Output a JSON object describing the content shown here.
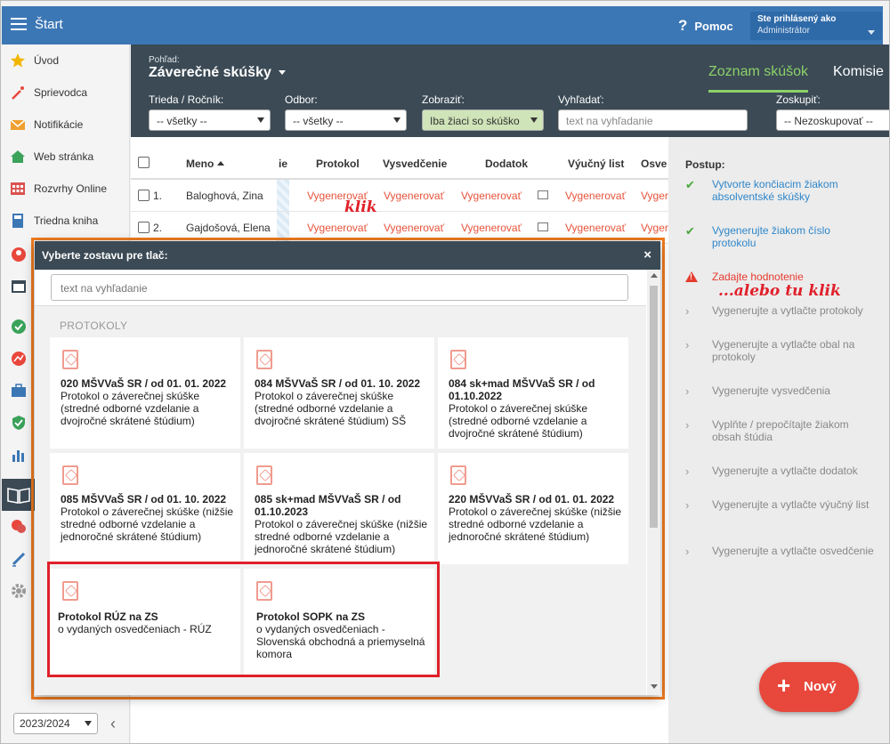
{
  "topbar": {
    "title": "Štart",
    "help": "Pomoc",
    "user_line1": "Ste prihlásený ako",
    "user_line2": "Administrátor"
  },
  "sidebar": {
    "items": [
      {
        "label": "Úvod",
        "icon": "star-icon",
        "color": "#f2b600"
      },
      {
        "label": "Sprievodca",
        "icon": "magic-wand-icon",
        "color": "#e8473c"
      },
      {
        "label": "Notifikácie",
        "icon": "envelope-icon",
        "color": "#f0a030"
      },
      {
        "label": "Web stránka",
        "icon": "home-icon",
        "color": "#3ba25a"
      },
      {
        "label": "Rozvrhy Online",
        "icon": "calendar-grid-icon",
        "color": "#d9534f"
      },
      {
        "label": "Triedna kniha",
        "icon": "book-icon",
        "color": "#3c77b5"
      }
    ],
    "year": "2023/2024"
  },
  "view": {
    "label": "Pohľad:",
    "title": "Záverečné skúšky",
    "tab_active": "Zoznam skúšok",
    "tab_other": "Komisie"
  },
  "filters": [
    {
      "label": "Trieda / Ročník:",
      "value": "-- všetky --"
    },
    {
      "label": "Odbor:",
      "value": "-- všetky --"
    },
    {
      "label": "Zobraziť:",
      "value": "Iba žiaci so skúško"
    },
    {
      "label": "Vyhľadať:",
      "value": "text na vyhľadanie"
    },
    {
      "label": "Zoskupiť:",
      "value": "-- Nezoskupovať --"
    }
  ],
  "table": {
    "headers": [
      "Meno",
      "ie",
      "Protokol",
      "Vysvedčenie",
      "Dodatok",
      "Výučný list",
      "Osve"
    ],
    "rows": [
      {
        "num": "1.",
        "name": "Baloghová, Zina",
        "protokol": "Vygenerovať",
        "vysvedcenie": "Vygenerovať",
        "dodatok": "Vygenerovať",
        "vyucny": "Vygenerovať",
        "osv": "Vyger"
      },
      {
        "num": "2.",
        "name": "Gajdošová, Elena",
        "protokol": "Vygenerovať",
        "vysvedcenie": "Vygenerovať",
        "dodatok": "Vygenerovať",
        "vyucny": "Vygenerovať",
        "osv": "Vyger"
      }
    ]
  },
  "annotations": {
    "klik": "klik",
    "alebo": "...alebo tu klik"
  },
  "steps": {
    "header": "Postup:",
    "items": [
      {
        "text": "Vytvorte končiacim žiakom absolventské skúšky",
        "state": "done"
      },
      {
        "text": "Vygenerujte žiakom číslo protokolu",
        "state": "done"
      },
      {
        "text": "Zadajte hodnotenie",
        "state": "warn"
      },
      {
        "text": "Vygenerujte a vytlačte protokoly",
        "state": "todo"
      },
      {
        "text": "Vygenerujte a vytlačte obal na protokoly",
        "state": "todo"
      },
      {
        "text": "Vygenerujte vysvedčenia",
        "state": "todo"
      },
      {
        "text": "Vyplňte / prepočítajte žiakom obsah štúdia",
        "state": "todo"
      },
      {
        "text": "Vygenerujte a vytlačte dodatok",
        "state": "todo"
      },
      {
        "text": "Vygenerujte a vytlačte výučný list",
        "state": "todo"
      },
      {
        "text": "Vygenerujte a vytlačte osvedčenie",
        "state": "todo"
      }
    ]
  },
  "new_button": "Nový",
  "modal": {
    "title": "Vyberte zostavu pre tlač:",
    "close": "×",
    "search_placeholder": "text na vyhľadanie",
    "section": "PROTOKOLY",
    "cards": [
      {
        "title": "020 MŠVVaŠ SR / od 01. 01. 2022",
        "desc": "Protokol o záverečnej skúške (stredné odborné vzdelanie a dvojročné skrátené štúdium)"
      },
      {
        "title": "084 MŠVVaŠ SR / od 01. 10. 2022",
        "desc": "Protokol o záverečnej skúške (stredné odborné vzdelanie a dvojročné skrátené štúdium) SŠ"
      },
      {
        "title": "084 sk+mad MŠVVaŠ SR / od 01.10.2022",
        "desc": "Protokol o záverečnej skúške (stredné odborné vzdelanie a dvojročné skrátené štúdium)"
      },
      {
        "title": "085 MŠVVaŠ SR / od 01. 10. 2022",
        "desc": "Protokol o záverečnej skúške (nižšie stredné odborné vzdelanie a jednoročné skrátené štúdium)"
      },
      {
        "title": "085 sk+mad MŠVVaŠ SR / od 01.10.2023",
        "desc": "Protokol o záverečnej skúške (nižšie stredné odborné vzdelanie a jednoročné skrátené štúdium)"
      },
      {
        "title": "220 MŠVVaŠ SR / od 01. 01. 2022",
        "desc": "Protokol o záverečnej skúške (nižšie stredné odborné vzdelanie a jednoročné skrátené štúdium)"
      },
      {
        "title": "Protokol RÚZ na ZS",
        "desc": "o vydaných osvedčeniach - RÚZ"
      },
      {
        "title": "Protokol SOPK na ZS",
        "desc": "o vydaných osvedčeniach - Slovenská obchodná a priemyselná komora"
      }
    ]
  },
  "colors": {
    "topbar": "#3c77b5",
    "header": "#3b4a55",
    "link": "#e6533b",
    "accent_green": "#8dd16a",
    "highlight_orange": "#f27c1f",
    "highlight_red": "#e0202a"
  }
}
